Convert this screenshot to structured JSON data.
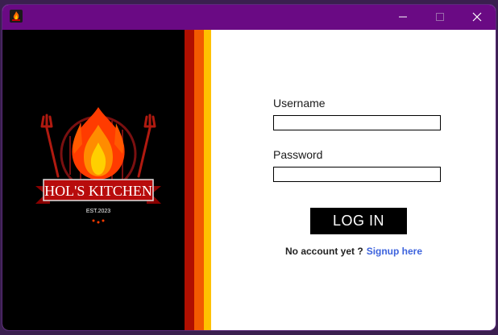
{
  "window": {
    "titlebar_color": "#6a0a84",
    "controls": {
      "minimize": "minimize-icon",
      "maximize": "maximize-icon",
      "close": "close-icon"
    }
  },
  "brand": {
    "name": "HOL'S KITCHEN",
    "established": "EST.2023",
    "panel_color": "#000000",
    "stripe_colors": [
      "#b00f00",
      "#f25a00",
      "#ffc100"
    ]
  },
  "form": {
    "username_label": "Username",
    "username_value": "",
    "password_label": "Password",
    "password_value": "",
    "login_label": "LOG IN",
    "no_account_text": "No account yet ?",
    "signup_link_text": "Signup here",
    "link_color": "#3d63dd"
  }
}
